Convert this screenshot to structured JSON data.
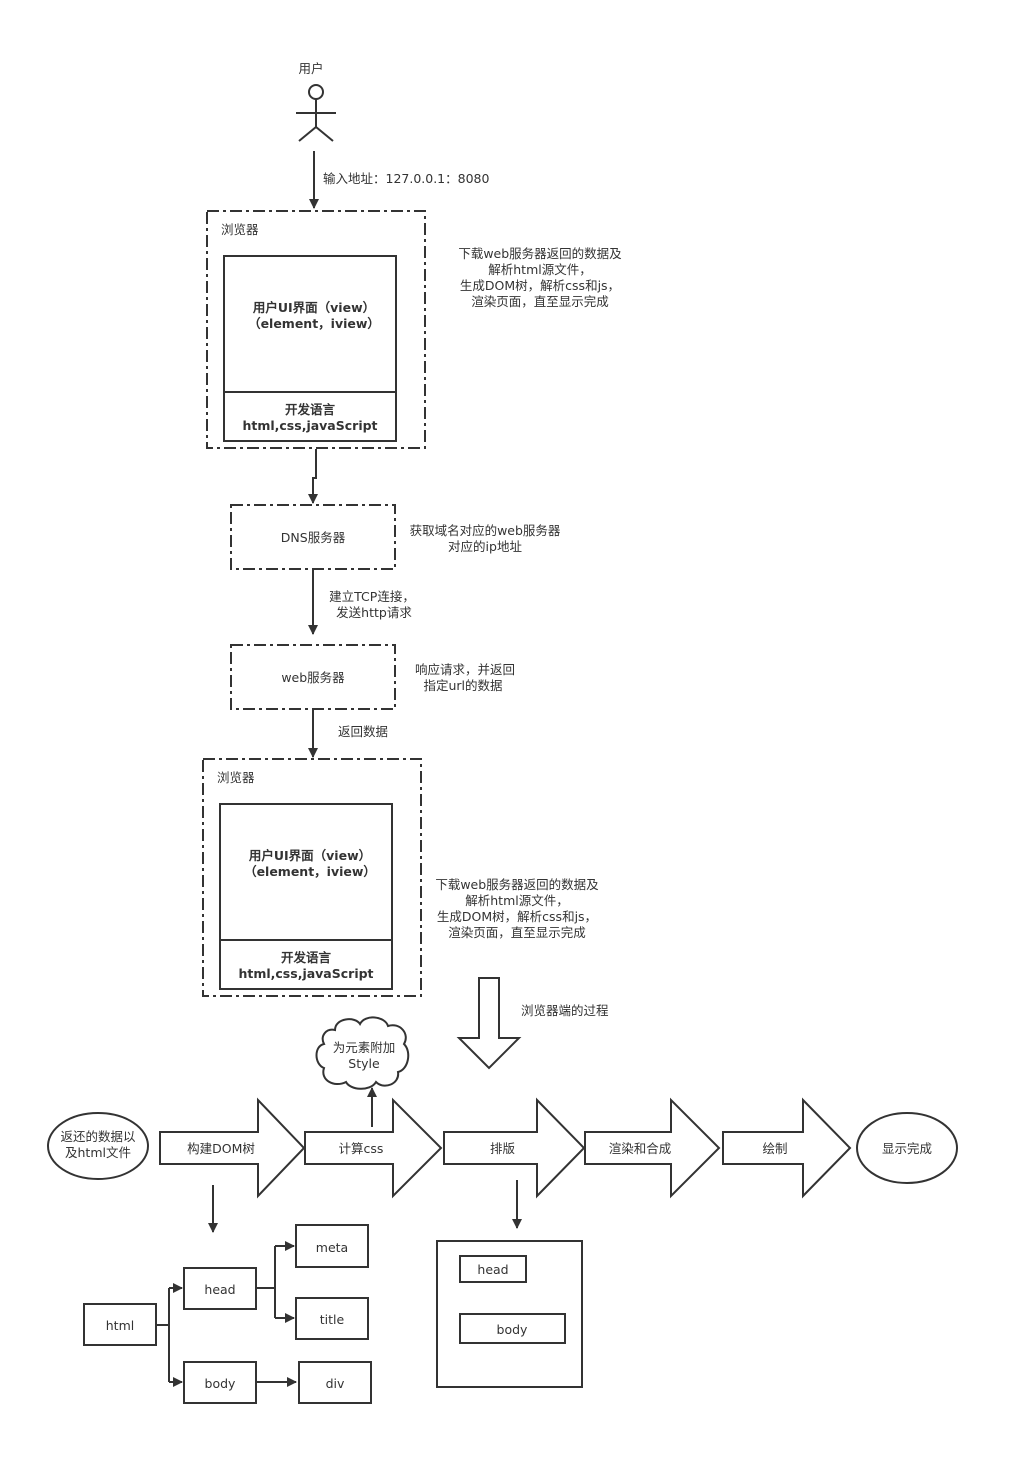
{
  "user": {
    "label": "用户"
  },
  "edges": {
    "input_address": "输入地址：127.0.0.1：8080",
    "tcp_connect": [
      "建立TCP连接，",
      "发送http请求"
    ],
    "return_data": "返回数据"
  },
  "browser_top": {
    "title": "浏览器",
    "ui_line1": "用户UI界面（view）",
    "ui_line2": "（element，iview）",
    "lang_title": "开发语言",
    "lang_value": "html,css,javaScript",
    "note": [
      "下载web服务器返回的数据及",
      "解析html源文件，",
      "生成DOM树，解析css和js，",
      "渲染页面，直至显示完成"
    ]
  },
  "dns": {
    "label": "DNS服务器",
    "note": [
      "获取域名对应的web服务器",
      "对应的ip地址"
    ]
  },
  "web_server": {
    "label": "web服务器",
    "note": [
      "响应请求，并返回",
      "指定url的数据"
    ]
  },
  "browser_bottom": {
    "title": "浏览器",
    "ui_line1": "用户UI界面（view）",
    "ui_line2": "（element，iview）",
    "lang_title": "开发语言",
    "lang_value": "html,css,javaScript",
    "note": [
      "下载web服务器返回的数据及",
      "解析html源文件，",
      "生成DOM树，解析css和js，",
      "渲染页面，直至显示完成"
    ]
  },
  "process": {
    "label": "浏览器端的过程",
    "start": [
      "返还的数据以",
      "及html文件"
    ],
    "steps": [
      "构建DOM树",
      "计算css",
      "排版",
      "渲染和合成",
      "绘制"
    ],
    "end": "显示完成",
    "cloud": [
      "为元素附加",
      "Style"
    ]
  },
  "dom_tree": {
    "root": "html",
    "head": "head",
    "body": "body",
    "meta": "meta",
    "title": "title",
    "div": "div"
  },
  "layout_box": {
    "head": "head",
    "body": "body"
  }
}
